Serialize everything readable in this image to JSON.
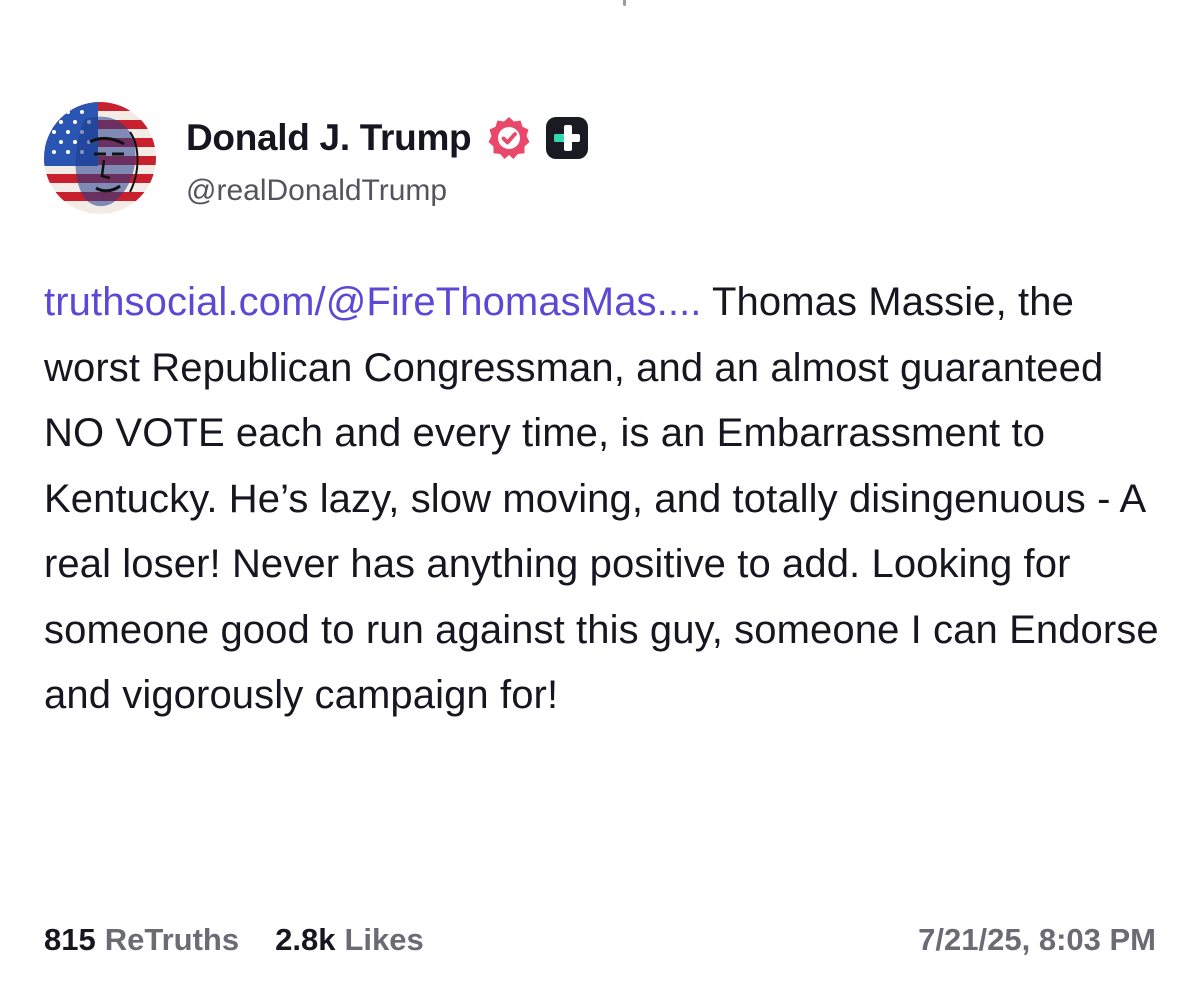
{
  "post": {
    "author": {
      "display_name": "Donald J. Trump",
      "handle": "@realDonaldTrump",
      "avatar_icon": "flag-portrait-avatar",
      "verified_icon": "verified-check-icon",
      "plus_badge_icon": "plus-badge-icon"
    },
    "link_text": "truthsocial.com/@FireThomasMas....",
    "text": " Thomas Massie, the worst Republican Congressman, and an almost guaranteed NO VOTE each and every time, is an Embarrassment to Kentucky. He’s lazy, slow moving, and totally disingenuous - A real loser! Never has anything positive to add. Looking for someone good to run against this guy, someone I can Endorse and vigorously campaign for!",
    "stats": {
      "retruths_count": "815",
      "retruths_label": "ReTruths",
      "likes_count": "2.8k",
      "likes_label": "Likes"
    },
    "timestamp": "7/21/25, 8:03 PM"
  },
  "colors": {
    "link": "#5b49d6",
    "text_primary": "#17151f",
    "text_secondary": "#6b6a75",
    "verified_badge": "#e8496a",
    "plus_badge_bg": "#1a1a22",
    "plus_badge_accent": "#30d8b0"
  }
}
